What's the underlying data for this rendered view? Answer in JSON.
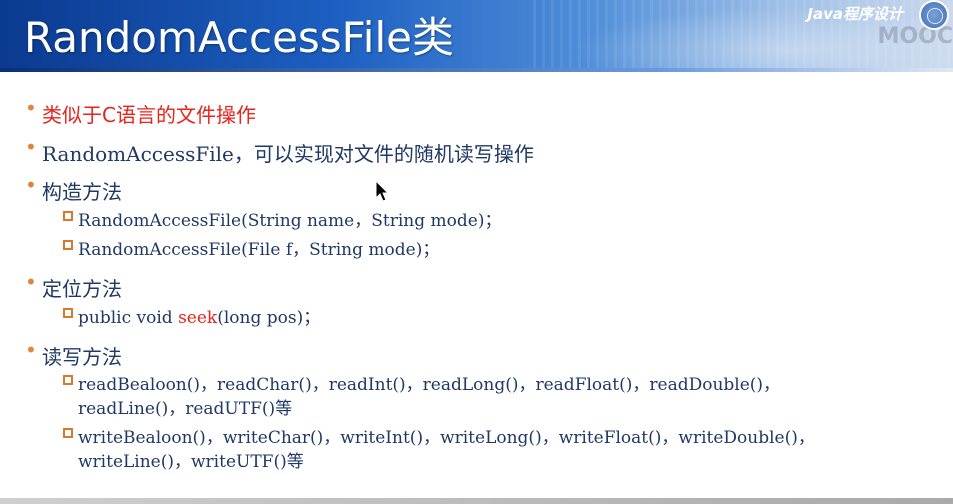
{
  "header": {
    "title": "RandomAccessFile类",
    "brand": "Java程序设计",
    "watermark": "MOOC"
  },
  "bullets": [
    {
      "text": "类似于C语言的文件操作",
      "color": "#e8231a"
    },
    {
      "text": "RandomAccessFile，可以实现对文件的随机读写操作"
    },
    {
      "text": "构造方法"
    },
    {
      "text": "定位方法"
    },
    {
      "text": "读写方法"
    }
  ],
  "constructors": [
    "RandomAccessFile(String name，String mode)；",
    "RandomAccessFile(File f，String mode)；"
  ],
  "seek": {
    "prefix": "public void ",
    "method": "seek",
    "suffix": "(long pos)；"
  },
  "read_methods": {
    "line1": "readBealoon()，readChar()，readInt()，readLong()，readFloat()，readDouble()，",
    "line2": "readLine()，readUTF()等"
  },
  "write_methods": {
    "line1": "writeBealoon()，writeChar()，writeInt()，writeLong()，writeFloat()，writeDouble()，",
    "line2": "writeLine()，writeUTF()等"
  },
  "colors": {
    "text": "#1f3864",
    "accent": "#e8231a",
    "bullet": "#e0843a"
  }
}
